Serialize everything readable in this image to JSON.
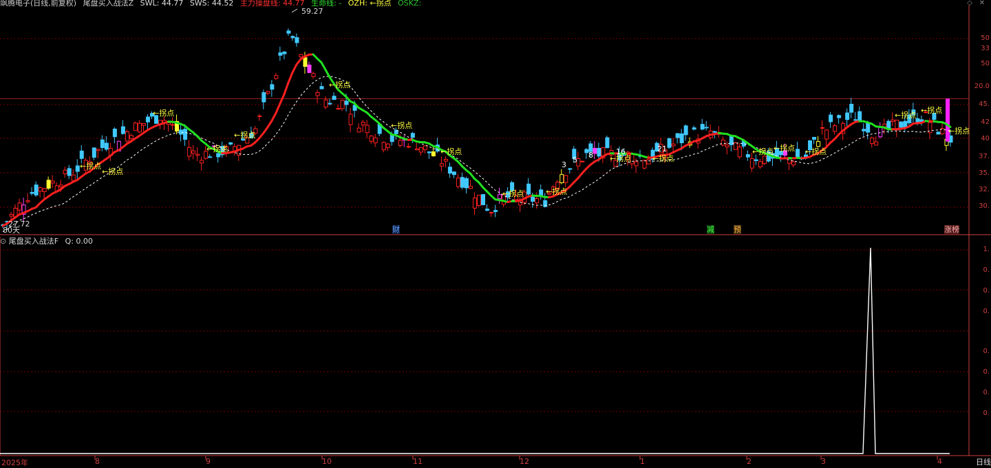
{
  "header": {
    "stock_title": "飒腾电子(日线,前复权)",
    "indicator_name": "尾盘买入战法Z",
    "swl_label": "SWL: 44.77",
    "sws_label": "SWS: 44.52",
    "main_force_label": "主力操盘线: 44.77",
    "lifeline_label": "生命线: -",
    "ozh_label": "OZH: ←拐点",
    "oskz_label": "OSKZ:"
  },
  "colors": {
    "up": "#ff2020",
    "down": "#40c8ff",
    "lifeline_up": "#ff2020",
    "lifeline_down": "#20e020",
    "grid": "#7a0000",
    "axis": "#d04040",
    "text_yellow": "#ffff40",
    "signal": "#ffffff"
  },
  "main_chart": {
    "high_price_label": "59.27",
    "low_price_label": "27.72",
    "period_label": "80天",
    "turn_label": "←拐点",
    "event_labels": [
      "财",
      "减",
      "预",
      "涨榜"
    ],
    "number_markers": [
      "3",
      "5",
      "8",
      "16",
      "21"
    ],
    "price_ticks": [
      "50",
      "33",
      "50",
      "20.0",
      "45.",
      "42",
      "40",
      "37.",
      "35.",
      "32.",
      "30."
    ],
    "reference_line": 47.6,
    "price_range": [
      27.0,
      61.5
    ]
  },
  "sub_chart": {
    "title": "尾盘买入战法F",
    "q_label": "Q: 0.00",
    "ticks": [
      "1.",
      "0.",
      "0.",
      "0.",
      "0.",
      "0.",
      "0.",
      "0."
    ],
    "signal_value_range": [
      0,
      1
    ]
  },
  "x_axis": {
    "labels": [
      "2025年",
      "8",
      "9",
      "10",
      "11",
      "12",
      "1",
      "2",
      "3",
      "4"
    ],
    "period_button": "日线"
  },
  "window_controls": [
    "restore-icon",
    "close-icon"
  ]
}
